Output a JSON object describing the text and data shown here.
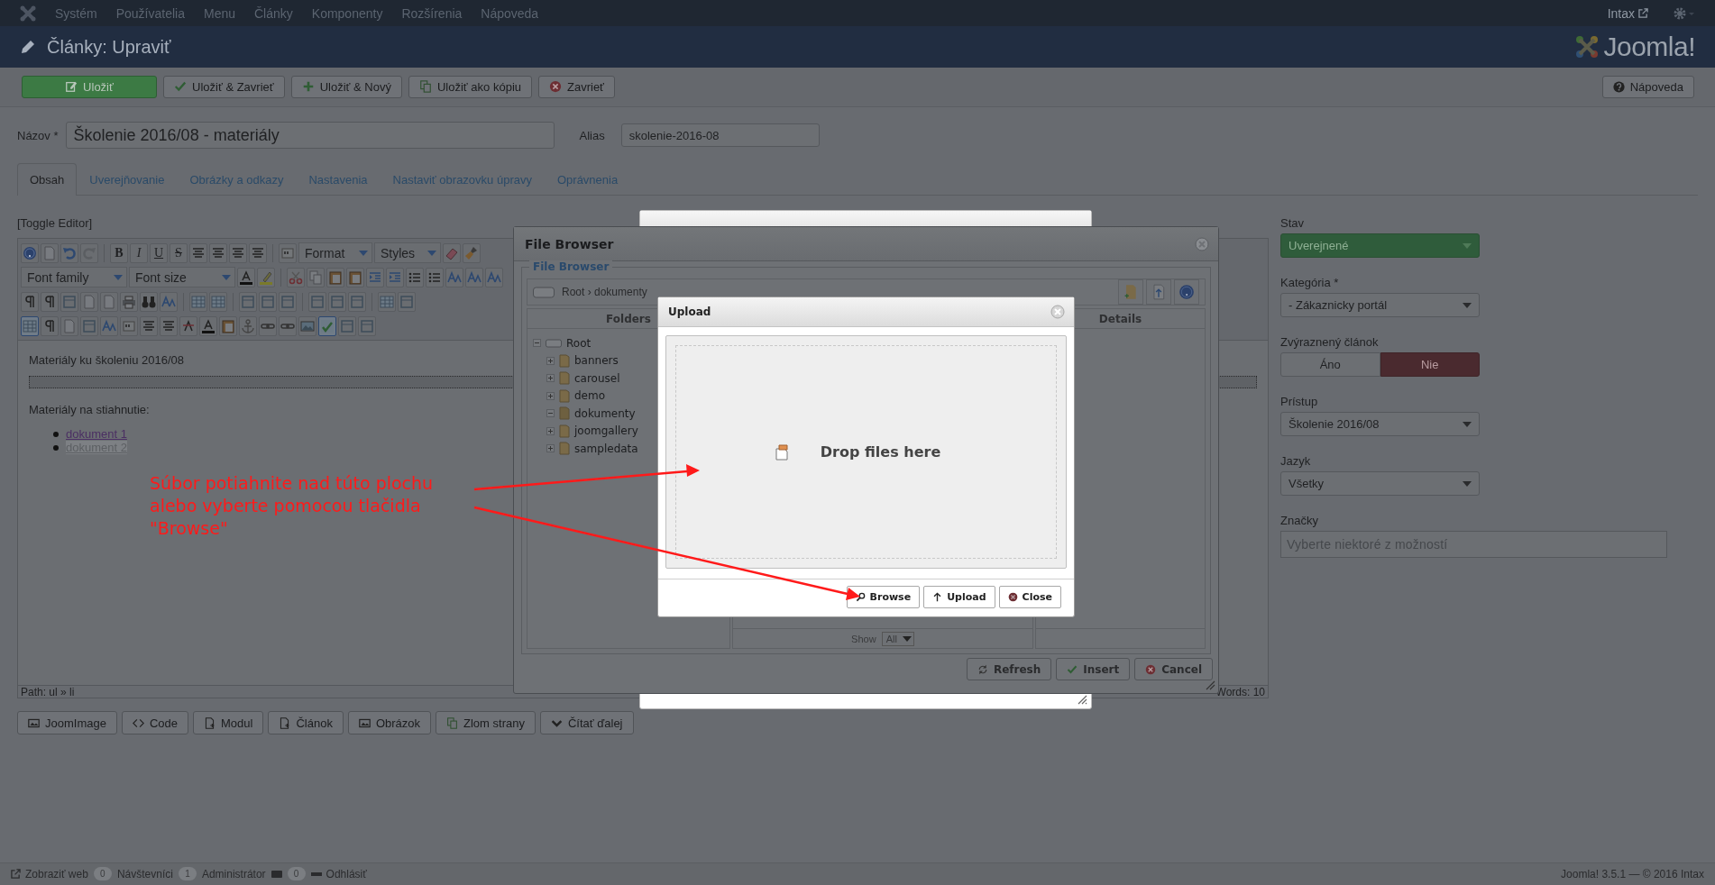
{
  "top_menu": {
    "items": [
      "Systém",
      "Používatelia",
      "Menu",
      "Články",
      "Komponenty",
      "Rozšírenia",
      "Nápoveda"
    ],
    "user": "Intax"
  },
  "header": {
    "title": "Články: Upraviť",
    "logo_text": "Joomla!"
  },
  "toolbar": {
    "buttons": [
      {
        "label": "Uložiť",
        "kind": "primary"
      },
      {
        "label": "Uložiť & Zavrieť",
        "kind": "check"
      },
      {
        "label": "Uložiť & Nový",
        "kind": "plus"
      },
      {
        "label": "Uložiť ako kópiu",
        "kind": "copy"
      },
      {
        "label": "Zavrieť",
        "kind": "close"
      }
    ],
    "help": "Nápoveda"
  },
  "title_field": {
    "label": "Názov *",
    "value": "Školenie 2016/08 - materiály"
  },
  "alias_field": {
    "label": "Alias",
    "value": "skolenie-2016-08"
  },
  "tabs": [
    {
      "label": "Obsah",
      "selected": true
    },
    {
      "label": "Uverejňovanie",
      "selected": false
    },
    {
      "label": "Obrázky a odkazy",
      "selected": false
    },
    {
      "label": "Nastavenia",
      "selected": false
    },
    {
      "label": "Nastaviť obrazovku úpravy",
      "selected": false
    },
    {
      "label": "Oprávnenia",
      "selected": false
    }
  ],
  "editor": {
    "toggle": "[Toggle Editor]",
    "glyphs": [
      "B",
      "I",
      "U",
      "S"
    ],
    "selects": [
      "Format",
      "Styles",
      "Font family",
      "Font size"
    ],
    "heading": "Materiály ku školeniu 2016/08",
    "subheading": "Materiály na stiahnutie:",
    "links": [
      {
        "text": "dokument 1",
        "selected": false
      },
      {
        "text": "dokument 2",
        "selected": true
      }
    ],
    "path": "Path: ul » li",
    "words": "Words: 10"
  },
  "editor_buttons": [
    {
      "label": "JoomImage",
      "kind": "image"
    },
    {
      "label": "Code",
      "kind": "code"
    },
    {
      "label": "Modul",
      "kind": "module"
    },
    {
      "label": "Článok",
      "kind": "article"
    },
    {
      "label": "Obrázok",
      "kind": "image"
    },
    {
      "label": "Zlom strany",
      "kind": "copy"
    },
    {
      "label": "Čítať ďalej",
      "kind": "chevron"
    }
  ],
  "sidebar": {
    "fields": [
      {
        "kind": "status",
        "label": "Stav",
        "value": "Uverejnené"
      },
      {
        "kind": "select",
        "label": "Kategória *",
        "value": "- Zákaznicky portál"
      },
      {
        "kind": "toggle",
        "label": "Zvýraznený článok",
        "options": [
          {
            "label": "Áno",
            "selected": false
          },
          {
            "label": "Nie",
            "selected": true
          }
        ]
      },
      {
        "kind": "select",
        "label": "Prístup",
        "value": "Školenie 2016/08"
      },
      {
        "kind": "select",
        "label": "Jazyk",
        "value": "Všetky"
      },
      {
        "kind": "tags",
        "label": "Značky",
        "placeholder": "Vyberte niektoré z možností"
      }
    ]
  },
  "file_browser": {
    "title": "File Browser",
    "legend": "File Browser",
    "breadcrumb": "Root › dokumenty",
    "folders_heading": "Folders",
    "details_heading": "Details",
    "tree": {
      "label": "Root",
      "expanded": true,
      "children": [
        {
          "label": "banners",
          "expanded": false
        },
        {
          "label": "carousel",
          "expanded": false
        },
        {
          "label": "demo",
          "expanded": false
        },
        {
          "label": "dokumenty",
          "expanded": true
        },
        {
          "label": "joomgallery",
          "expanded": false
        },
        {
          "label": "sampledata",
          "expanded": false
        }
      ]
    },
    "show_label": "Show",
    "show_value": "All",
    "buttons": [
      {
        "label": "Refresh",
        "kind": "refresh"
      },
      {
        "label": "Insert",
        "kind": "check"
      },
      {
        "label": "Cancel",
        "kind": "close"
      }
    ]
  },
  "upload_dialog": {
    "title": "Upload",
    "drop_text": "Drop files here",
    "buttons": [
      {
        "label": "Browse",
        "kind": "browse"
      },
      {
        "label": "Upload",
        "kind": "upload"
      },
      {
        "label": "Close",
        "kind": "close"
      }
    ]
  },
  "annotation": {
    "lines": [
      "Súbor potiahnite nad túto plochu",
      "alebo vyberte pomocou tlačidla",
      "\"Browse\""
    ]
  },
  "status_bar": {
    "items": [
      {
        "kind": "link",
        "label": "Zobraziť web"
      },
      {
        "kind": "count",
        "count": "0",
        "label": "Návštevníci"
      },
      {
        "kind": "count",
        "count": "1",
        "label": "Administrátor"
      },
      {
        "kind": "messages",
        "count": "0"
      },
      {
        "kind": "logout",
        "label": "Odhlásiť"
      }
    ],
    "copyright": "Joomla! 3.5.1 — © 2016 Intax"
  }
}
